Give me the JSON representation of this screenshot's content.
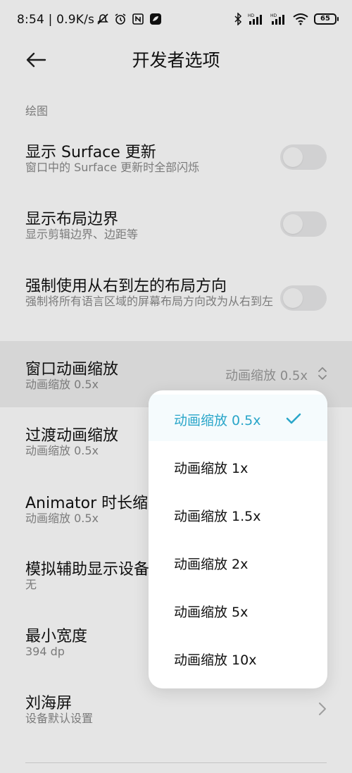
{
  "status_bar": {
    "time": "8:54 | 0.9K/s",
    "battery": "65",
    "left_icons": [
      "mute-icon",
      "alarm-icon",
      "nfc-icon",
      "app-notification-icon"
    ],
    "right_icons": [
      "bluetooth-icon",
      "signal-hd-icon",
      "signal-hd-icon",
      "wifi-icon",
      "battery-icon"
    ]
  },
  "header": {
    "title": "开发者选项",
    "back_icon": "back-arrow-icon"
  },
  "section": {
    "label": "绘图"
  },
  "settings": [
    {
      "title": "显示 Surface 更新",
      "subtitle": "窗口中的 Surface 更新时全部闪烁",
      "control": "toggle",
      "on": false
    },
    {
      "title": "显示布局边界",
      "subtitle": "显示剪辑边界、边距等",
      "control": "toggle",
      "on": false
    },
    {
      "title": "强制使用从右到左的布局方向",
      "subtitle": "强制将所有语言区域的屏幕布局方向改为从右到左",
      "control": "toggle",
      "on": false
    },
    {
      "title": "窗口动画缩放",
      "subtitle": "动画缩放 0.5x",
      "control": "select",
      "value": "动画缩放 0.5x"
    },
    {
      "title": "过渡动画缩放",
      "subtitle": "动画缩放 0.5x"
    },
    {
      "title": "Animator 时长缩放",
      "title_visible": "Animator 时长缩",
      "subtitle": "动画缩放 0.5x"
    },
    {
      "title_visible": "模拟辅助显示设备",
      "subtitle": "无"
    },
    {
      "title": "最小宽度",
      "subtitle": "394 dp"
    },
    {
      "title": "刘海屏",
      "subtitle": "设备默认设置",
      "control": "chevron"
    }
  ],
  "dropdown": {
    "selected_index": 0,
    "accent_color": "#2aa6c9",
    "options": [
      "动画缩放 0.5x",
      "动画缩放 1x",
      "动画缩放 1.5x",
      "动画缩放 2x",
      "动画缩放 5x",
      "动画缩放 10x"
    ]
  }
}
